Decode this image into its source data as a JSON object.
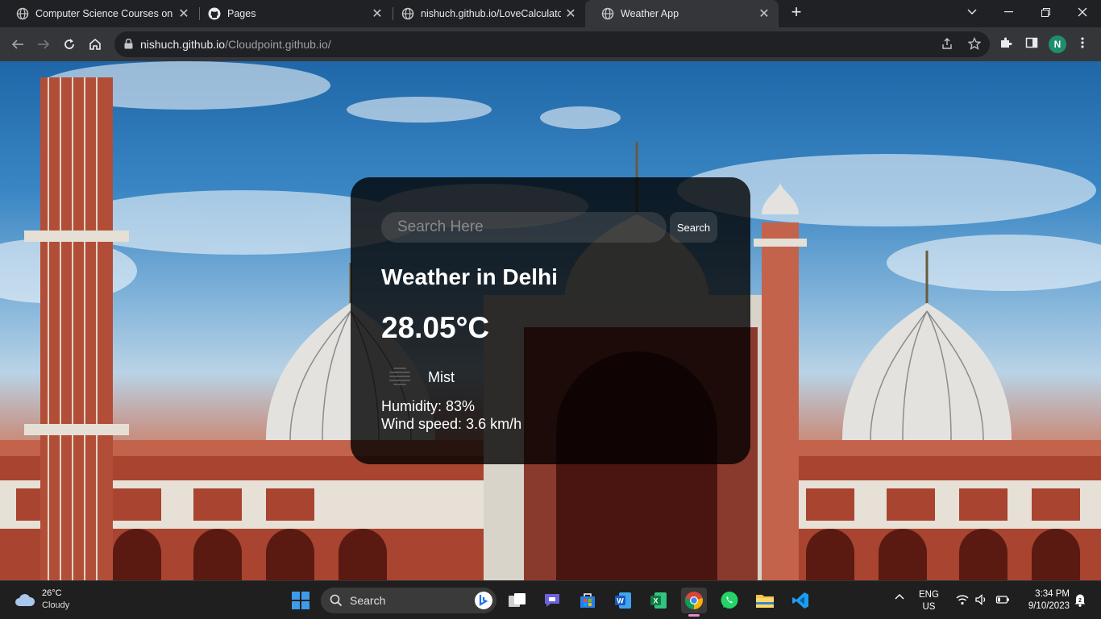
{
  "browser": {
    "tabs": [
      {
        "title": "Computer Science Courses on Le",
        "close": "✕",
        "active": false,
        "icon": "globe-icon"
      },
      {
        "title": "Pages",
        "close": "✕",
        "active": false,
        "icon": "github-icon"
      },
      {
        "title": "nishuch.github.io/LoveCalculator",
        "close": "✕",
        "active": false,
        "icon": "globe-icon"
      },
      {
        "title": "Weather App",
        "close": "✕",
        "active": true,
        "icon": "globe-icon"
      }
    ],
    "new_tab": "+",
    "url_host": "nishuch.github.io",
    "url_path": "/Cloudpoint.github.io/",
    "profile_initial": "N",
    "profile_color": "#1e8e6e"
  },
  "app": {
    "search_placeholder": "Search Here",
    "search_button": "Search",
    "city_heading": "Weather in Delhi",
    "temperature": "28.05°C",
    "condition": "Mist",
    "condition_icon": "mist-icon",
    "humidity": "Humidity: 83%",
    "wind": "Wind speed: 3.6 km/h",
    "card_background": "rgba(0,0,0,0.8)"
  },
  "taskbar": {
    "weather_temp": "26°C",
    "weather_desc": "Cloudy",
    "search_label": "Search",
    "lang_line1": "ENG",
    "lang_line2": "US",
    "time": "3:34 PM",
    "date": "9/10/2023"
  }
}
